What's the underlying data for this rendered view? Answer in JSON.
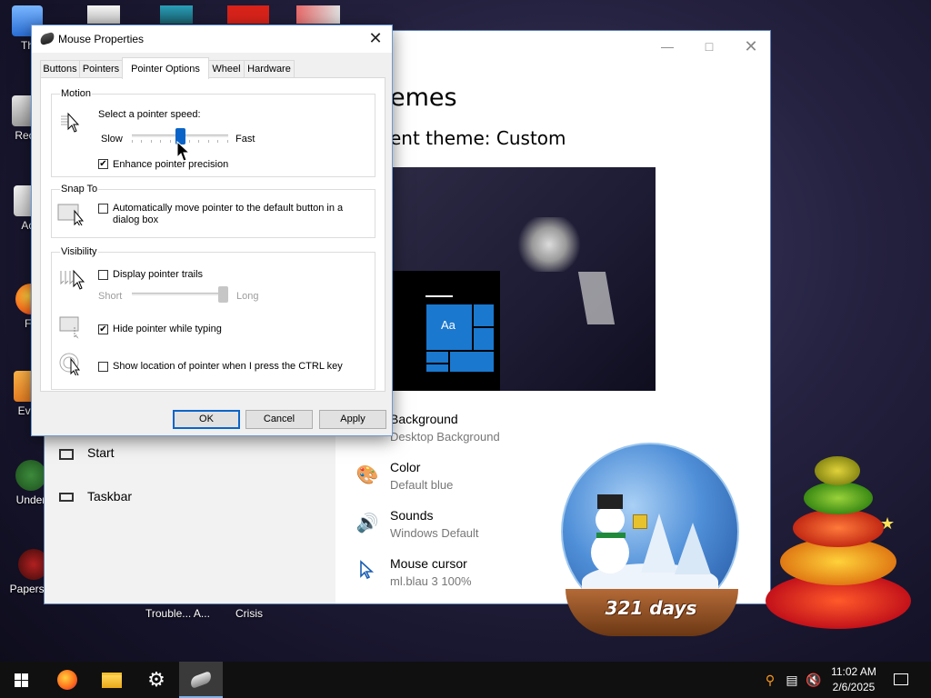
{
  "desktop": {
    "icon_labels": [
      "Th",
      "Recy",
      "Act",
      "Fir",
      "Ever",
      "Under",
      "Papers, P"
    ],
    "bottom_labels": [
      "Trouble... A...",
      "Crisis"
    ]
  },
  "settings_window": {
    "heading": "emes",
    "current_theme": "ent theme: Custom",
    "preview_tile_text": "Aa",
    "sidebar": [
      {
        "label": "Start",
        "icon": "start-icon"
      },
      {
        "label": "Taskbar",
        "icon": "taskbar-icon"
      }
    ],
    "items": [
      {
        "title": "Background",
        "subtitle": "Desktop Background",
        "icon": "background-icon"
      },
      {
        "title": "Color",
        "subtitle": "Default blue",
        "icon": "palette-icon"
      },
      {
        "title": "Sounds",
        "subtitle": "Windows Default",
        "icon": "speaker-icon"
      },
      {
        "title": "Mouse cursor",
        "subtitle": "ml.blau 3 100%",
        "icon": "cursor-icon"
      }
    ]
  },
  "mouse_dialog": {
    "title": "Mouse Properties",
    "tabs": [
      "Buttons",
      "Pointers",
      "Pointer Options",
      "Wheel",
      "Hardware"
    ],
    "active_tab": "Pointer Options",
    "motion": {
      "group_title": "Motion",
      "prompt": "Select a pointer speed:",
      "slow_label": "Slow",
      "fast_label": "Fast",
      "speed_fraction": 0.5,
      "enhance_label": "Enhance pointer precision",
      "enhance_checked": true
    },
    "snap_to": {
      "group_title": "Snap To",
      "label_line1": "Automatically move pointer to the default button in a",
      "label_line2": "dialog box",
      "checked": false
    },
    "visibility": {
      "group_title": "Visibility",
      "trails_label": "Display pointer trails",
      "trails_checked": false,
      "short_label": "Short",
      "long_label": "Long",
      "trail_length_fraction": 1.0,
      "hide_label": "Hide pointer while typing",
      "hide_checked": true,
      "ctrl_label": "Show location of pointer when I press the CTRL key",
      "ctrl_checked": false
    },
    "buttons": {
      "ok": "OK",
      "cancel": "Cancel",
      "apply": "Apply"
    }
  },
  "snow_globe": {
    "days_text": "321 days"
  },
  "taskbar": {
    "items": [
      "start-icon",
      "firefox-icon",
      "file-explorer-icon",
      "settings-icon",
      "mouse-icon"
    ],
    "tray_icons": [
      "search-icon",
      "network-icon",
      "volume-muted-icon",
      "notification-icon"
    ],
    "time": "11:02 AM",
    "date": "2/6/2025"
  },
  "colors": {
    "accent": "#0a64c8",
    "tile_blue": "#1a78cf",
    "settings_icon_blue": "#1a5fb4"
  }
}
